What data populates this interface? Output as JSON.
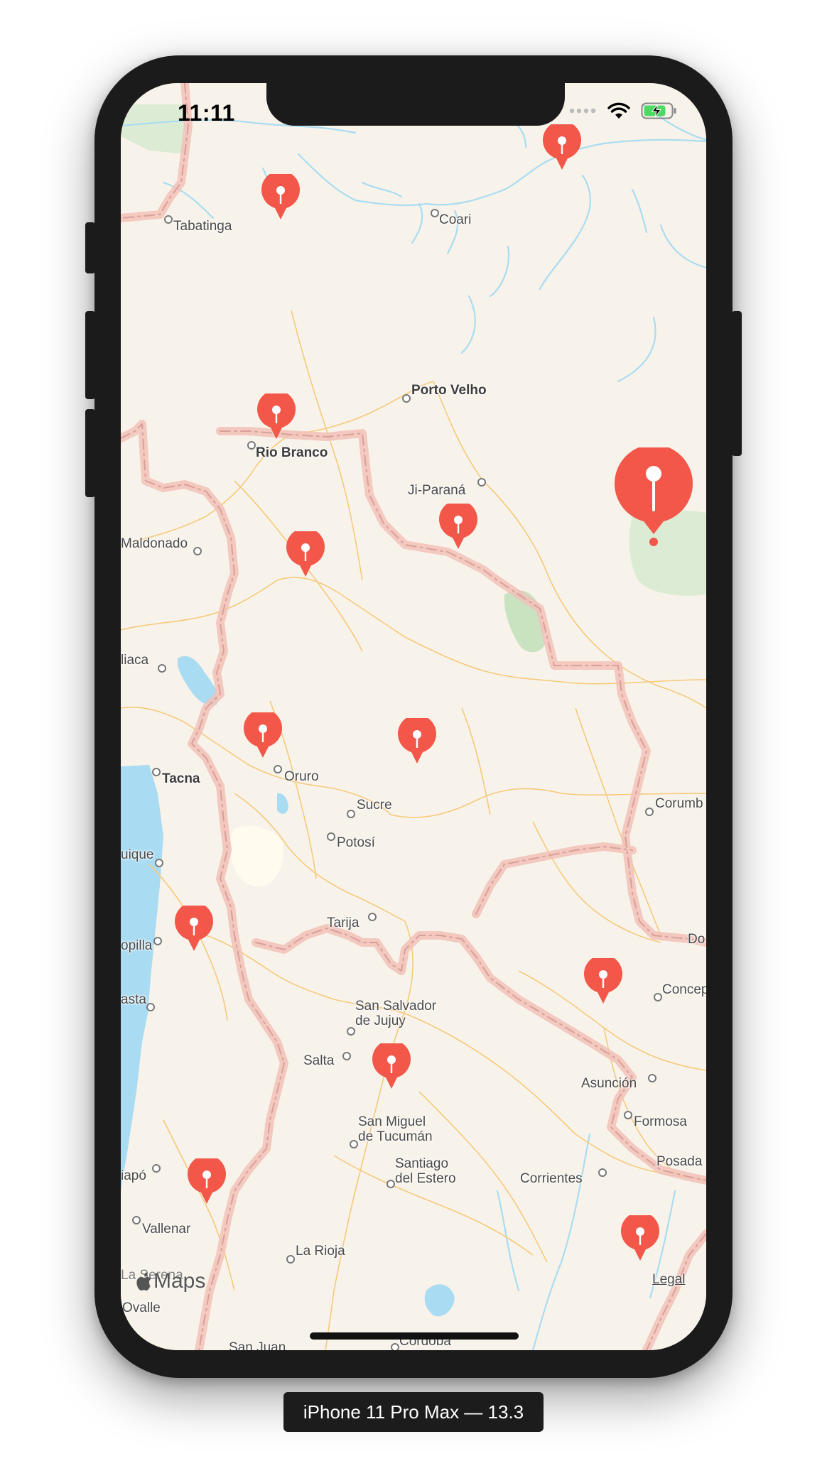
{
  "status_bar": {
    "time": "11:11",
    "icons": [
      "signal-dots-icon",
      "wifi-icon",
      "battery-charging-icon"
    ]
  },
  "map": {
    "labels": {
      "tabatinga": "Tabatinga",
      "coari": "Coari",
      "porto_velho": "Porto Velho",
      "rio_branco": "Rio Branco",
      "ji_parana": "Ji-Paraná",
      "maldonado": "Maldonado",
      "liaca": "liaca",
      "tacna": "Tacna",
      "oruro": "Oruro",
      "sucre": "Sucre",
      "potosi": "Potosí",
      "corumba": "Corumb",
      "iquique": "uique",
      "tarija": "Tarija",
      "tocopilla": "opilla",
      "do": "Do",
      "concep": "Concep",
      "asta": "asta",
      "san_salvador_1": "San Salvador",
      "san_salvador_2": "de Jujuy",
      "salta": "Salta",
      "asuncion": "Asunción",
      "formosa": "Formosa",
      "san_miguel_1": "San Miguel",
      "san_miguel_2": "de Tucumán",
      "santiago_1": "Santiago",
      "santiago_2": "del Estero",
      "corrientes": "Corrientes",
      "posada": "Posada",
      "iapo": "iapó",
      "vallenar": "Vallenar",
      "la_rioja": "La Rioja",
      "la_serena": "La Serena",
      "legal": "Legal",
      "ovalle": "Ovalle",
      "san_juan": "San Juan",
      "cordoba": "Córdoba"
    },
    "legal_logo": "Maps"
  },
  "colors": {
    "land": "#f8f3ea",
    "water": "#a9dcf2",
    "park": "#dcebd3",
    "road": "#f6c97b",
    "border": "#f2b9b0",
    "pin": "#f2574a"
  },
  "caption": "iPhone 11 Pro Max — 13.3"
}
